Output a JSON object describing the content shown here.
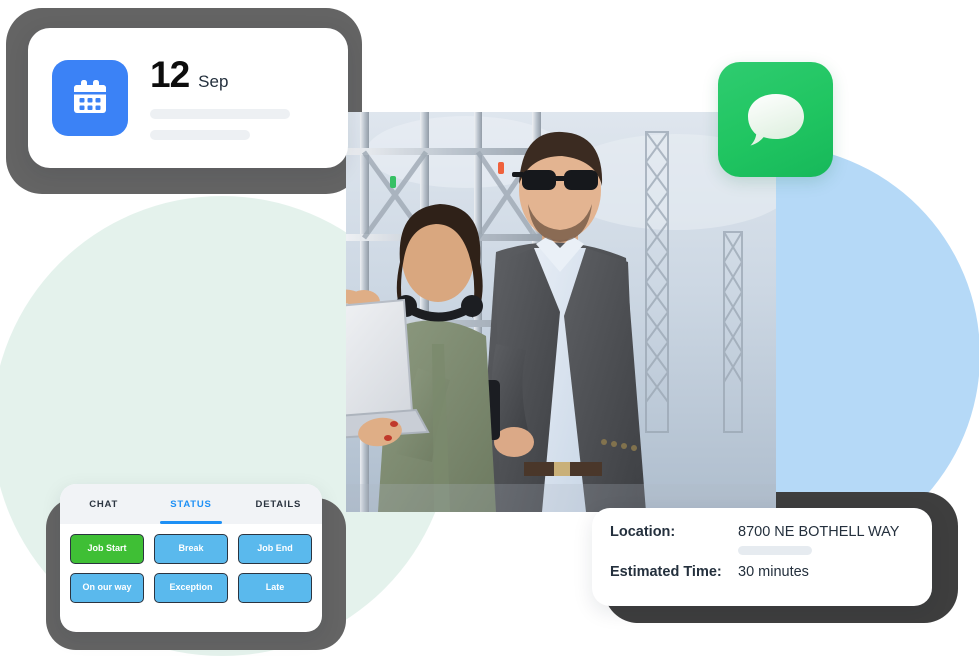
{
  "date_card": {
    "icon": "calendar-icon",
    "day": "12",
    "month": "Sep",
    "skeleton_lines": 2
  },
  "chat_tile": {
    "icon": "chat-bubble-icon",
    "color": "#20c561"
  },
  "photo": {
    "alt": "Two professionals at a construction site with scaffolding; woman holding a laptop and pointing, man in gray suit wearing sunglasses holding a two-way radio"
  },
  "status_card": {
    "tabs": [
      {
        "label": "CHAT",
        "active": false
      },
      {
        "label": "STATUS",
        "active": true
      },
      {
        "label": "DETAILS",
        "active": false
      }
    ],
    "buttons": [
      {
        "label": "Job Start",
        "color": "#3fbf35",
        "style": "green"
      },
      {
        "label": "Break",
        "color": "#5ab9ed",
        "style": "blue"
      },
      {
        "label": "Job End",
        "color": "#5ab9ed",
        "style": "blue"
      },
      {
        "label": "On our way",
        "color": "#5ab9ed",
        "style": "blue"
      },
      {
        "label": "Exception",
        "color": "#5ab9ed",
        "style": "blue"
      },
      {
        "label": "Late",
        "color": "#5ab9ed",
        "style": "blue"
      }
    ]
  },
  "location_card": {
    "location_label": "Location:",
    "location_value": "8700 NE BOTHELL WAY",
    "time_label": "Estimated Time:",
    "time_value": "30 minutes"
  },
  "theme": {
    "accent_blue": "#1e90f5",
    "calendar_blue": "#3b82f6",
    "button_blue": "#5ab9ed",
    "button_green": "#3fbf35",
    "frame_gray": "#646464",
    "frame_dark": "#3e3e3e",
    "circle_mint": "#dff0e9",
    "circle_blue": "#b5d9f7"
  }
}
